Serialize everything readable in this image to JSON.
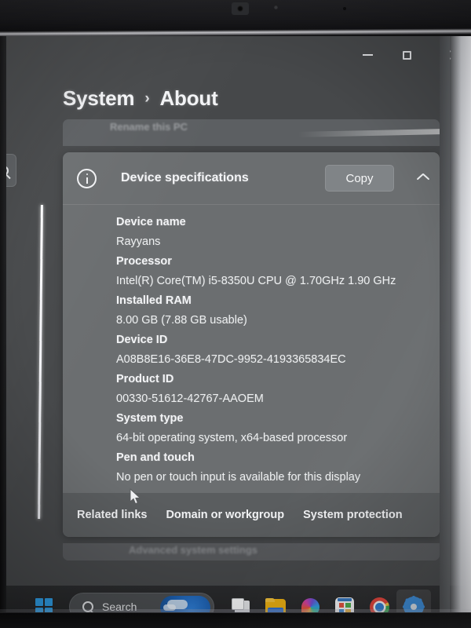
{
  "window": {
    "minimize_label": "Minimize",
    "maximize_label": "Maximize",
    "close_label": "Close"
  },
  "breadcrumb": {
    "root": "System",
    "separator": "›",
    "current": "About"
  },
  "sidebar": {
    "search_icon": "search-icon"
  },
  "partial_card_above": {
    "text": "Rename this PC"
  },
  "device_specifications": {
    "icon": "info-icon",
    "title": "Device specifications",
    "copy_label": "Copy",
    "collapse_icon": "chevron-up-icon",
    "rows": [
      {
        "label": "Device name",
        "value": "Rayyans"
      },
      {
        "label": "Processor",
        "value": "Intel(R) Core(TM) i5-8350U CPU @ 1.70GHz   1.90 GHz"
      },
      {
        "label": "Installed RAM",
        "value": "8.00 GB (7.88 GB usable)"
      },
      {
        "label": "Device ID",
        "value": "A08B8E16-36E8-47DC-9952-4193365834EC"
      },
      {
        "label": "Product ID",
        "value": "00330-51612-42767-AAOEM"
      },
      {
        "label": "System type",
        "value": "64-bit operating system, x64-based processor"
      },
      {
        "label": "Pen and touch",
        "value": "No pen or touch input is available for this display"
      }
    ],
    "related": {
      "label": "Related links",
      "links": [
        "Domain or workgroup",
        "System protection"
      ]
    }
  },
  "partial_card_below": {
    "text": "Advanced system settings"
  },
  "taskbar": {
    "start_label": "Start",
    "search": {
      "icon": "search-icon",
      "placeholder": "Search",
      "value": "Search",
      "weather_widget": "weather-widget"
    },
    "items": [
      {
        "name": "task-view",
        "label": "Task View"
      },
      {
        "name": "file-explorer",
        "label": "File Explorer"
      },
      {
        "name": "copilot",
        "label": "Copilot"
      },
      {
        "name": "microsoft-store",
        "label": "Microsoft Store"
      },
      {
        "name": "google-chrome",
        "label": "Google Chrome"
      },
      {
        "name": "settings",
        "label": "Settings",
        "active": true
      }
    ]
  },
  "colors": {
    "page_background": "#46484a",
    "card_background": "#6b6e70",
    "related_bar": "#5a5d5f",
    "text_primary": "#f3f4f6",
    "taskbar": "#252628",
    "active_indicator": "#c08ad8",
    "accent_blue": "#3a8ede"
  },
  "cursor": {
    "name": "mouse-pointer"
  }
}
